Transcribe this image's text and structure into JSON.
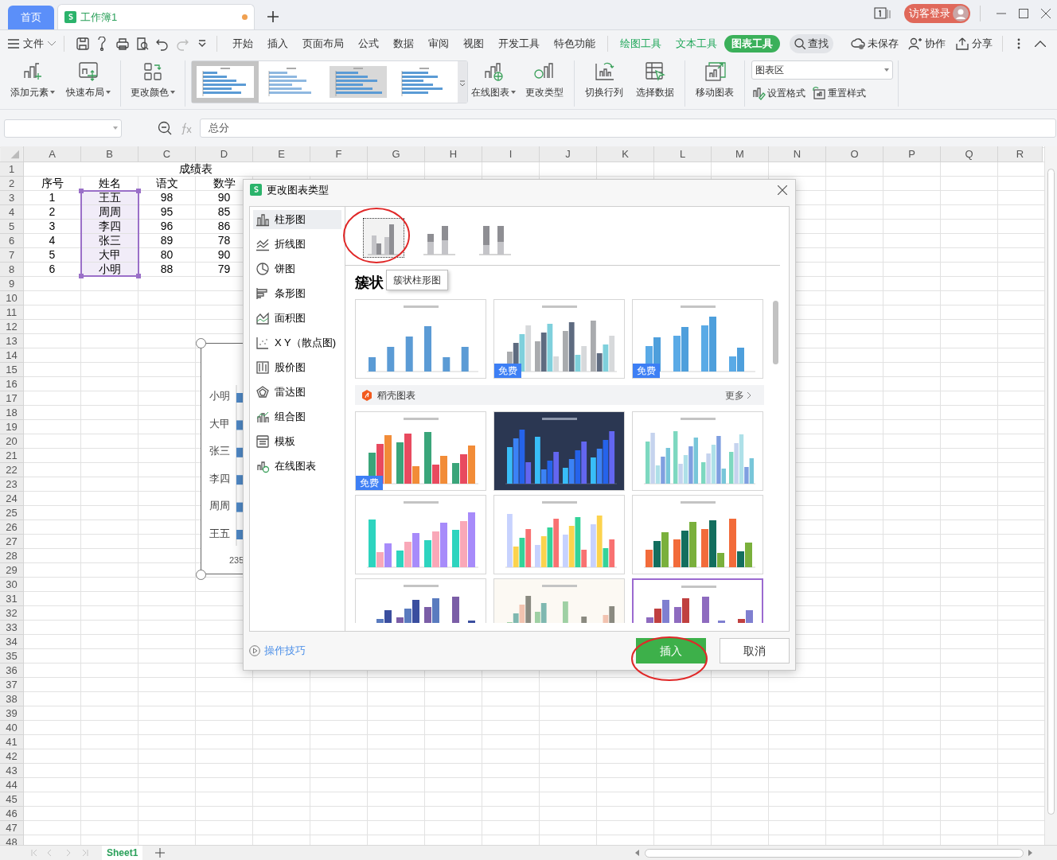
{
  "tabs": [
    {
      "label": "首页",
      "kind": "home",
      "selected": false
    },
    {
      "label": "工作簿1",
      "kind": "doc",
      "selected": true,
      "unsaved": true
    }
  ],
  "window": {
    "login": "访客登录"
  },
  "menu": {
    "file": "文件",
    "tabs": [
      {
        "label": "开始",
        "kind": "tab",
        "selected": false
      },
      {
        "label": "插入",
        "kind": "tab",
        "selected": false
      },
      {
        "label": "页面布局",
        "kind": "tab",
        "selected": false
      },
      {
        "label": "公式",
        "kind": "tab",
        "selected": false
      },
      {
        "label": "数据",
        "kind": "tab",
        "selected": false
      },
      {
        "label": "审阅",
        "kind": "tab",
        "selected": false
      },
      {
        "label": "视图",
        "kind": "tab",
        "selected": false
      },
      {
        "label": "开发工具",
        "kind": "tab",
        "selected": false
      },
      {
        "label": "特色功能",
        "kind": "tab",
        "selected": false
      },
      {
        "label": "绘图工具",
        "kind": "tool",
        "selected": false
      },
      {
        "label": "文本工具",
        "kind": "tool",
        "selected": false
      },
      {
        "label": "图表工具",
        "kind": "tool",
        "selected": true
      }
    ],
    "search": "查找",
    "actions": [
      "未保存",
      "协作",
      "分享"
    ]
  },
  "ribbon": {
    "left": [
      {
        "label": "添加元素",
        "dropdown": true
      },
      {
        "label": "快速布局",
        "dropdown": true
      },
      {
        "label": "更改颜色",
        "dropdown": true
      }
    ],
    "styles": [
      {
        "selected": true
      },
      {
        "selected": false
      },
      {
        "selected": false
      },
      {
        "selected": false
      }
    ],
    "right": [
      {
        "label": "在线图表",
        "dropdown": true
      },
      {
        "label": "更改类型",
        "dropdown": false
      },
      {
        "label": "切换行列",
        "dropdown": false
      },
      {
        "label": "选择数据",
        "dropdown": false
      },
      {
        "label": "移动图表",
        "dropdown": false
      }
    ],
    "element_select": "图表区",
    "format_actions": [
      "设置格式",
      "重置样式"
    ]
  },
  "formula_bar": {
    "formula": "总分"
  },
  "sheet": {
    "columns": [
      "A",
      "B",
      "C",
      "D",
      "E",
      "F",
      "G",
      "H",
      "I",
      "J",
      "K",
      "L",
      "M",
      "N",
      "O",
      "P",
      "Q",
      "R"
    ],
    "title": "成绩表",
    "rows": [
      {
        "cells": [
          {
            "text": "序号",
            "selected": false
          },
          {
            "text": "姓名",
            "selected": false
          },
          {
            "text": "语文",
            "selected": false
          },
          {
            "text": "数学",
            "selected": false
          }
        ]
      },
      {
        "cells": [
          {
            "text": "1",
            "selected": false
          },
          {
            "text": "王五",
            "selected": true
          },
          {
            "text": "98",
            "selected": false
          },
          {
            "text": "90",
            "selected": false
          }
        ]
      },
      {
        "cells": [
          {
            "text": "2",
            "selected": false
          },
          {
            "text": "周周",
            "selected": true
          },
          {
            "text": "95",
            "selected": false
          },
          {
            "text": "85",
            "selected": false
          }
        ]
      },
      {
        "cells": [
          {
            "text": "3",
            "selected": false
          },
          {
            "text": "李四",
            "selected": true
          },
          {
            "text": "96",
            "selected": false
          },
          {
            "text": "86",
            "selected": false
          }
        ]
      },
      {
        "cells": [
          {
            "text": "4",
            "selected": false
          },
          {
            "text": "张三",
            "selected": true
          },
          {
            "text": "89",
            "selected": false
          },
          {
            "text": "78",
            "selected": false
          }
        ]
      },
      {
        "cells": [
          {
            "text": "5",
            "selected": false
          },
          {
            "text": "大甲",
            "selected": true
          },
          {
            "text": "80",
            "selected": false
          },
          {
            "text": "90",
            "selected": false
          }
        ]
      },
      {
        "cells": [
          {
            "text": "6",
            "selected": false
          },
          {
            "text": "小明",
            "selected": true
          },
          {
            "text": "88",
            "selected": false
          },
          {
            "text": "79",
            "selected": false
          }
        ]
      }
    ],
    "row_numbers": [
      "1",
      "2",
      "3",
      "4",
      "5",
      "6",
      "7",
      "8",
      "9",
      "10",
      "11",
      "12",
      "13",
      "14",
      "15",
      "16",
      "17",
      "18",
      "19",
      "20",
      "21",
      "22",
      "23",
      "24",
      "25",
      "26",
      "27",
      "28",
      "29",
      "30",
      "31",
      "32",
      "33",
      "34",
      "35",
      "36",
      "37",
      "38",
      "39",
      "40",
      "41",
      "42",
      "43",
      "44",
      "45",
      "46",
      "47",
      "48"
    ]
  },
  "chart_object": {
    "labels": [
      "小明",
      "大甲",
      "张三",
      "李四",
      "周周",
      "王五"
    ],
    "axis_tick": "235"
  },
  "dialog": {
    "title": "更改图表类型",
    "categories": [
      {
        "label": "柱形图",
        "selected": true
      },
      {
        "label": "折线图",
        "selected": false
      },
      {
        "label": "饼图",
        "selected": false
      },
      {
        "label": "条形图",
        "selected": false
      },
      {
        "label": "面积图",
        "selected": false
      },
      {
        "label": "X Y（散点图)",
        "selected": false
      },
      {
        "label": "股价图",
        "selected": false
      },
      {
        "label": "雷达图",
        "selected": false
      },
      {
        "label": "组合图",
        "selected": false
      },
      {
        "label": "模板",
        "selected": false
      },
      {
        "label": "在线图表",
        "selected": false
      }
    ],
    "subtypes": [
      {
        "selected": true
      },
      {
        "selected": false
      },
      {
        "selected": false
      }
    ],
    "tooltip": "簇状柱形图",
    "heading": "簇状",
    "templates": [
      {
        "kind": "light",
        "selected": false
      },
      {
        "kind": "light",
        "badge": "免费",
        "selected": false
      },
      {
        "kind": "light",
        "badge": "免费",
        "selected": false
      }
    ],
    "section": {
      "title": "稻壳图表",
      "more": "更多"
    },
    "docer_templates": [
      {
        "kind": "light",
        "badge": "免费",
        "selected": false
      },
      {
        "kind": "dark",
        "selected": false
      },
      {
        "kind": "light",
        "selected": false
      },
      {
        "kind": "light",
        "selected": false
      },
      {
        "kind": "light",
        "selected": false
      },
      {
        "kind": "light",
        "selected": false
      },
      {
        "kind": "light",
        "selected": false
      },
      {
        "kind": "cream",
        "selected": false
      },
      {
        "kind": "light",
        "selected": true
      }
    ],
    "tips": "操作技巧",
    "buttons": [
      {
        "label": "插入",
        "kind": "primary"
      },
      {
        "label": "取消",
        "kind": "secondary"
      }
    ]
  },
  "sheet_tabs": [
    {
      "label": "Sheet1",
      "selected": true
    }
  ]
}
